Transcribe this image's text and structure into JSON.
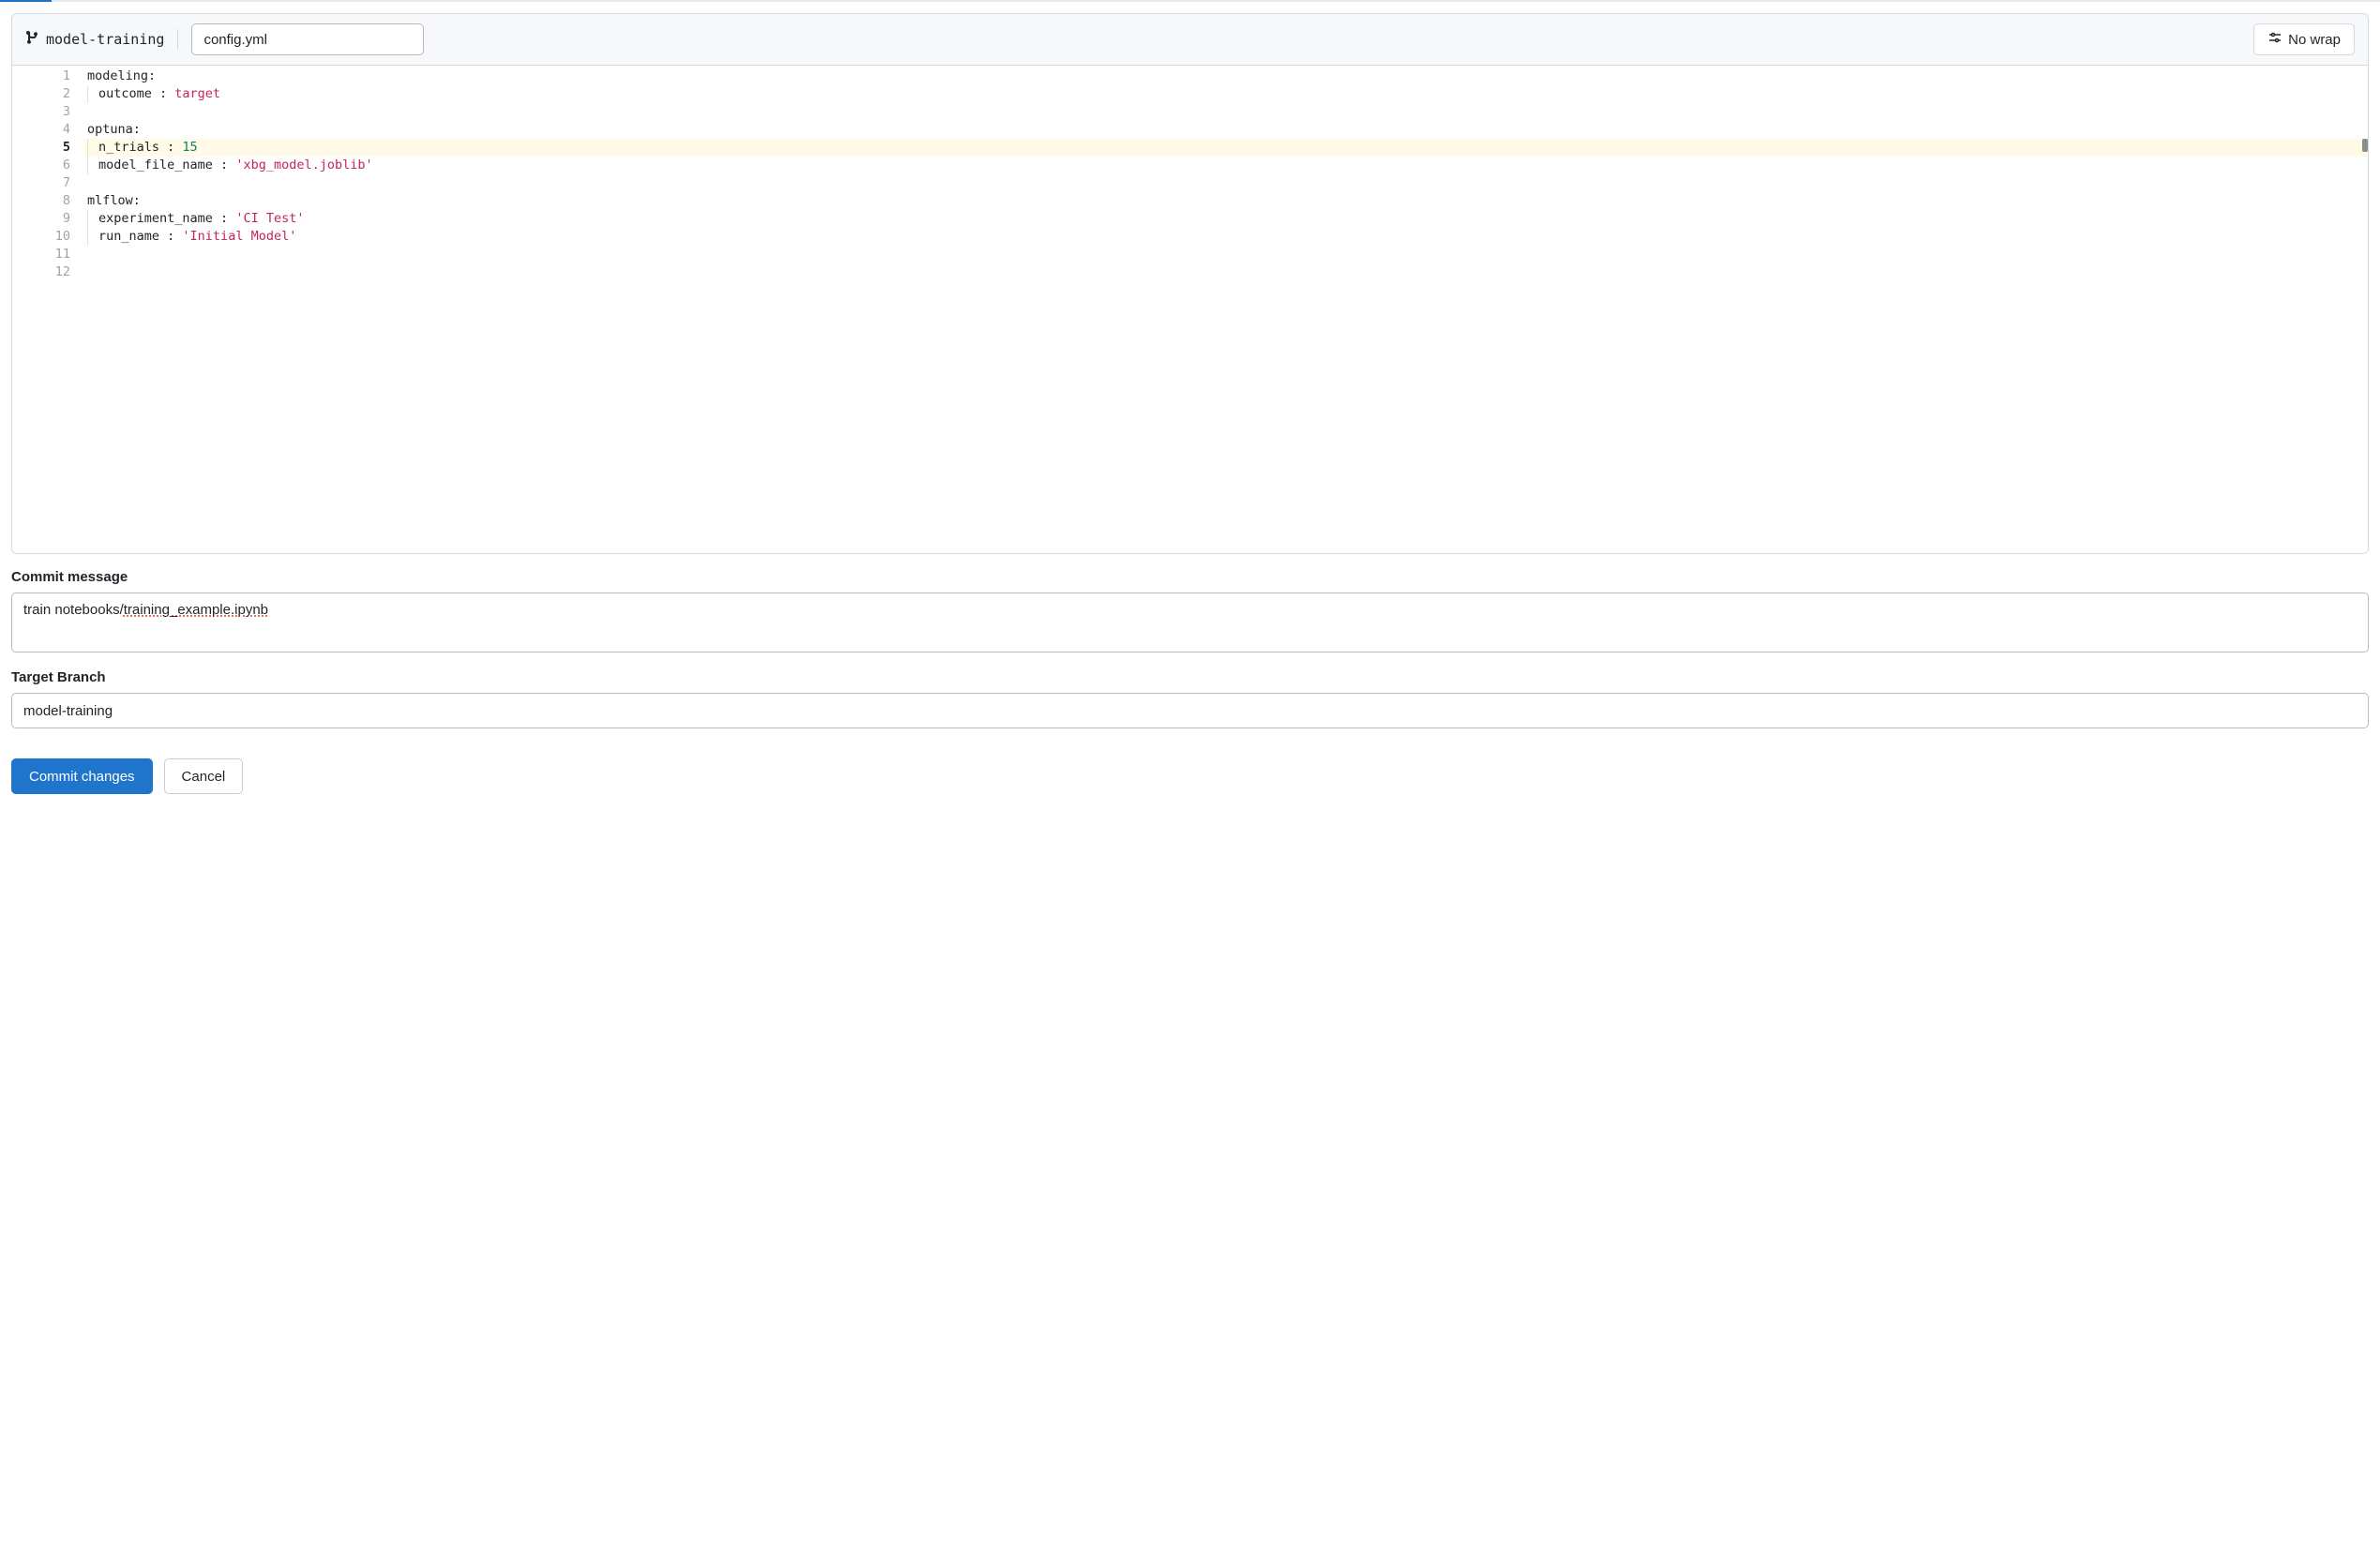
{
  "toolbar": {
    "branch": "model-training",
    "filename": "config.yml",
    "nowrap_label": "No wrap"
  },
  "editor": {
    "line_count": 12,
    "active_line": 5,
    "lines": [
      [
        {
          "t": "key",
          "v": "modeling"
        },
        {
          "t": "punct",
          "v": ":"
        }
      ],
      [
        {
          "t": "indent"
        },
        {
          "t": "key",
          "v": "outcome "
        },
        {
          "t": "punct",
          "v": ": "
        },
        {
          "t": "str",
          "v": "target"
        }
      ],
      [],
      [
        {
          "t": "key",
          "v": "optuna"
        },
        {
          "t": "punct",
          "v": ":"
        }
      ],
      [
        {
          "t": "indent"
        },
        {
          "t": "key",
          "v": "n_trials "
        },
        {
          "t": "punct",
          "v": ": "
        },
        {
          "t": "num",
          "v": "15"
        }
      ],
      [
        {
          "t": "indent"
        },
        {
          "t": "key",
          "v": "model_file_name "
        },
        {
          "t": "punct",
          "v": ": "
        },
        {
          "t": "str",
          "v": "'xbg_model.joblib'"
        }
      ],
      [],
      [
        {
          "t": "key",
          "v": "mlflow"
        },
        {
          "t": "punct",
          "v": ":"
        }
      ],
      [
        {
          "t": "indent"
        },
        {
          "t": "key",
          "v": "experiment_name "
        },
        {
          "t": "punct",
          "v": ": "
        },
        {
          "t": "str",
          "v": "'CI Test'"
        }
      ],
      [
        {
          "t": "indent"
        },
        {
          "t": "key",
          "v": "run_name "
        },
        {
          "t": "punct",
          "v": ": "
        },
        {
          "t": "str",
          "v": "'Initial Model'"
        }
      ],
      [],
      []
    ]
  },
  "form": {
    "commit_message_label": "Commit message",
    "commit_message_pre": "train notebooks/",
    "commit_message_spell": "training_example.ipynb",
    "target_branch_label": "Target Branch",
    "target_branch_value": "model-training",
    "commit_button": "Commit changes",
    "cancel_button": "Cancel"
  }
}
